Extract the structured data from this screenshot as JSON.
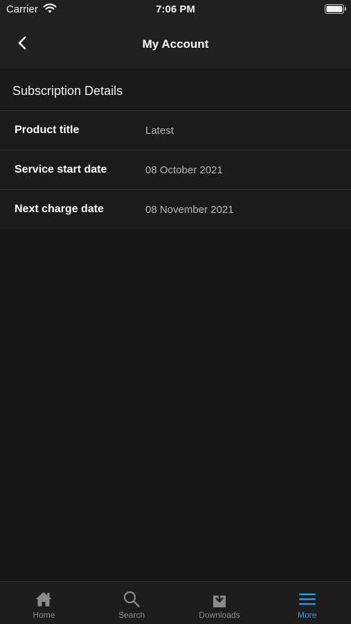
{
  "status_bar": {
    "carrier": "Carrier",
    "time": "7:06 PM"
  },
  "nav": {
    "title": "My Account",
    "back_icon": "chevron-left-icon"
  },
  "section": {
    "title": "Subscription Details"
  },
  "details": [
    {
      "label": "Product title",
      "value": "Latest"
    },
    {
      "label": "Service start date",
      "value": "08 October 2021"
    },
    {
      "label": "Next charge date",
      "value": "08 November 2021"
    }
  ],
  "tabs": [
    {
      "label": "Home",
      "icon": "home-icon",
      "active": false
    },
    {
      "label": "Search",
      "icon": "search-icon",
      "active": false
    },
    {
      "label": "Downloads",
      "icon": "download-icon",
      "active": false
    },
    {
      "label": "More",
      "icon": "menu-icon",
      "active": true
    }
  ],
  "colors": {
    "background": "#161616",
    "bar": "#202020",
    "accent": "#2f9be0",
    "inactive_tab": "#8a8a8a",
    "value_text": "#b8b8b8"
  }
}
